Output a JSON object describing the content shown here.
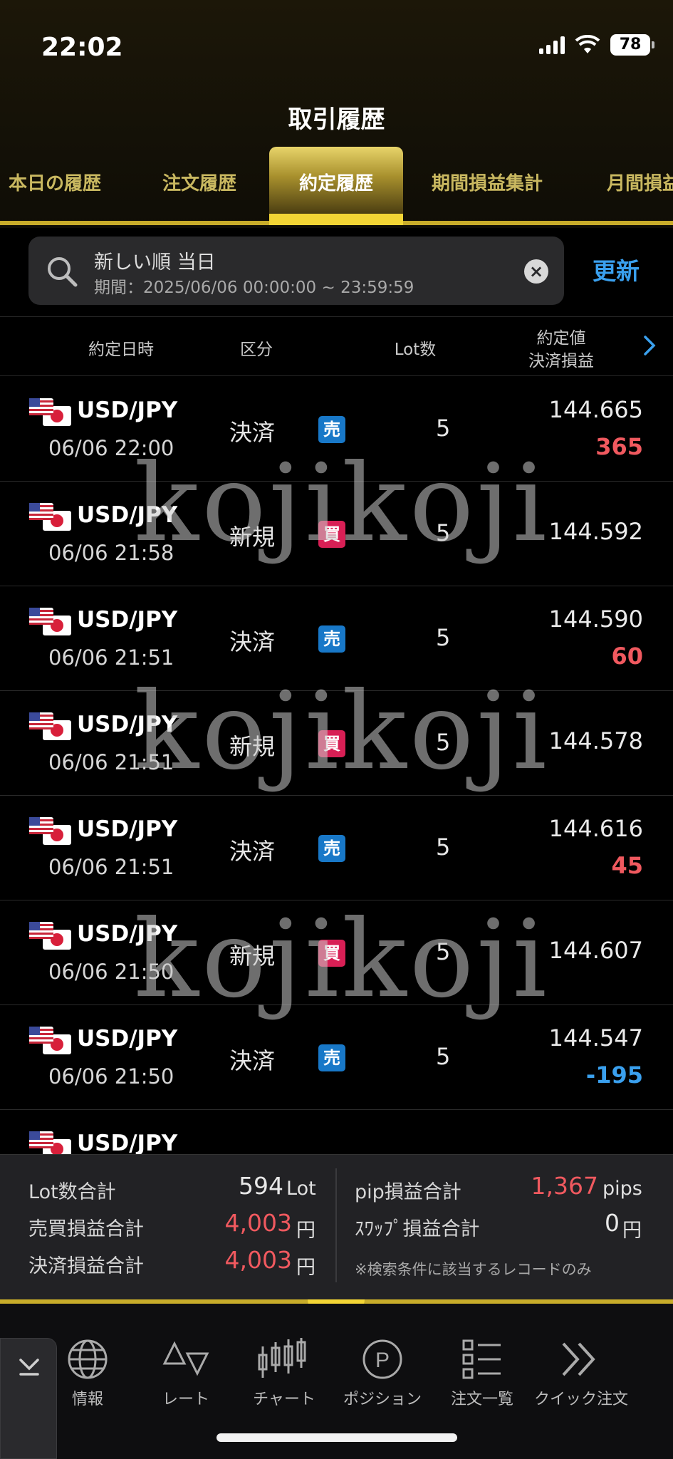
{
  "status_bar": {
    "time": "22:02",
    "battery": "78"
  },
  "header": {
    "title": "取引履歴"
  },
  "tabs": [
    "本日の履歴",
    "注文履歴",
    "約定履歴",
    "期間損益集計",
    "月間損益"
  ],
  "active_tab": "約定履歴",
  "search": {
    "line1": "新しい順 当日",
    "line2": "期間：2025/06/06 00:00:00 ~ 23:59:59",
    "refresh_label": "更新"
  },
  "columns": {
    "datetime": "約定日時",
    "kind": "区分",
    "lot": "Lot数",
    "price": "約定値",
    "pl": "決済損益"
  },
  "rows": [
    {
      "pair": "USD/JPY",
      "datetime": "06/06 22:00",
      "kind": "決済",
      "side": "売",
      "lot": "5",
      "price": "144.665",
      "pl": "365"
    },
    {
      "pair": "USD/JPY",
      "datetime": "06/06 21:58",
      "kind": "新規",
      "side": "買",
      "lot": "5",
      "price": "144.592",
      "pl": ""
    },
    {
      "pair": "USD/JPY",
      "datetime": "06/06 21:51",
      "kind": "決済",
      "side": "売",
      "lot": "5",
      "price": "144.590",
      "pl": "60"
    },
    {
      "pair": "USD/JPY",
      "datetime": "06/06 21:51",
      "kind": "新規",
      "side": "買",
      "lot": "5",
      "price": "144.578",
      "pl": ""
    },
    {
      "pair": "USD/JPY",
      "datetime": "06/06 21:51",
      "kind": "決済",
      "side": "売",
      "lot": "5",
      "price": "144.616",
      "pl": "45"
    },
    {
      "pair": "USD/JPY",
      "datetime": "06/06 21:50",
      "kind": "新規",
      "side": "買",
      "lot": "5",
      "price": "144.607",
      "pl": ""
    },
    {
      "pair": "USD/JPY",
      "datetime": "06/06 21:50",
      "kind": "決済",
      "side": "売",
      "lot": "5",
      "price": "144.547",
      "pl": "-195"
    },
    {
      "pair": "USD/JPY",
      "datetime": "",
      "kind": "",
      "side": "",
      "lot": "",
      "price": "",
      "pl": ""
    }
  ],
  "watermark": "kojikoji",
  "summary": {
    "lot_total_label": "Lot数合計",
    "lot_total_value": "594",
    "lot_unit": "Lot",
    "trade_pl_label": "売買損益合計",
    "trade_pl_value": "4,003",
    "yen": "円",
    "settle_pl_label": "決済損益合計",
    "settle_pl_value": "4,003",
    "pip_label": "pip損益合計",
    "pip_value": "1,367",
    "pip_unit": "pips",
    "swap_label": "ｽﾜｯﾌﾟ損益合計",
    "swap_value": "0",
    "note": "※検索条件に該当するレコードのみ"
  },
  "bottom_nav": [
    {
      "label": "情報",
      "icon": "globe-icon"
    },
    {
      "label": "レート",
      "icon": "rate-icon"
    },
    {
      "label": "チャート",
      "icon": "chart-icon"
    },
    {
      "label": "ポジション",
      "icon": "position-icon"
    },
    {
      "label": "注文一覧",
      "icon": "order-list-icon"
    },
    {
      "label": "クイック注文",
      "icon": "quick-order-icon"
    }
  ],
  "colors": {
    "accent": "#f3d535",
    "profit": "#f0595f",
    "loss": "#3aa0ee",
    "sell": "#1878c8",
    "buy": "#d81f55"
  }
}
